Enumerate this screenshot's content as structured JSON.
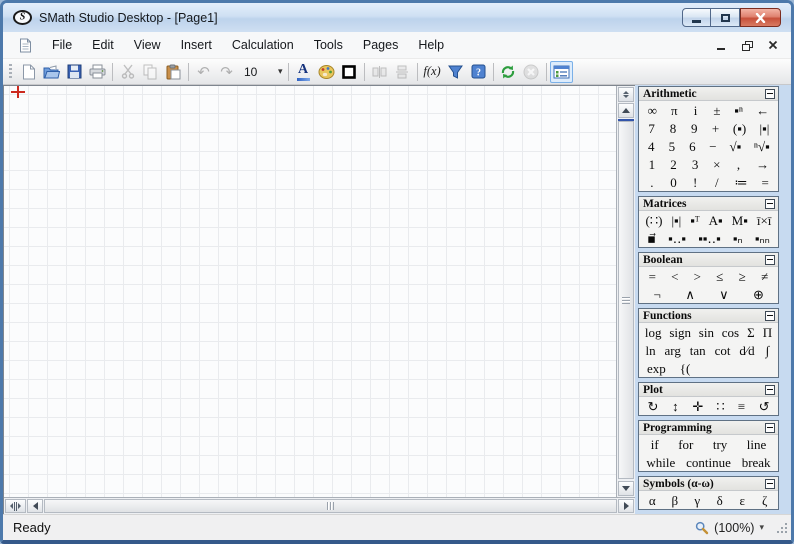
{
  "window": {
    "title": "SMath Studio Desktop - [Page1]",
    "logo_letter": "S"
  },
  "menu": {
    "items": [
      "File",
      "Edit",
      "View",
      "Insert",
      "Calculation",
      "Tools",
      "Pages",
      "Help"
    ]
  },
  "toolbar": {
    "font_size": "10",
    "font_color_label": "A",
    "fx_label": "f(x)",
    "reference_glyph": "?",
    "icons": {
      "undo": "↶",
      "redo": "↷",
      "dropdown_arrow": "▾"
    }
  },
  "palettes": [
    {
      "title": "Arithmetic",
      "rows": [
        [
          "∞",
          "π",
          "i",
          "±",
          "▪ⁿ",
          "←"
        ],
        [
          "7",
          "8",
          "9",
          "+",
          "(▪)",
          "|▪|"
        ],
        [
          "4",
          "5",
          "6",
          "−",
          "√▪",
          "ⁿ√▪"
        ],
        [
          "1",
          "2",
          "3",
          "×",
          ",",
          "→"
        ],
        [
          ".",
          "0",
          "!",
          "/",
          "≔",
          "="
        ]
      ]
    },
    {
      "title": "Matrices",
      "rows": [
        [
          "(∷)",
          "|▪|",
          "▪ᵀ",
          "A▪",
          "M▪",
          "ī×ī"
        ],
        [
          "▪⃗",
          "▪‥▪",
          "▪▪‥▪",
          "▪ₙ",
          "▪ₙₙ"
        ]
      ]
    },
    {
      "title": "Boolean",
      "rows": [
        [
          "=",
          "<",
          ">",
          "≤",
          "≥",
          "≠"
        ],
        [
          "¬",
          "∧",
          "∨",
          "⊕"
        ]
      ]
    },
    {
      "title": "Functions",
      "rows": [
        [
          "log",
          "sign",
          "sin",
          "cos",
          "Σ",
          "Π"
        ],
        [
          "ln",
          "arg",
          "tan",
          "cot",
          "d⁄d",
          "∫"
        ],
        [
          "exp",
          "{("
        ]
      ]
    },
    {
      "title": "Plot",
      "rows": [
        [
          "↻",
          "↕",
          "✛",
          "∷",
          "≡",
          "↺"
        ]
      ]
    },
    {
      "title": "Programming",
      "rows": [
        [
          "if",
          "for",
          "try",
          "line"
        ],
        [
          "while",
          "continue",
          "break"
        ]
      ]
    },
    {
      "title": "Symbols (α-ω)",
      "rows": [
        [
          "α",
          "β",
          "γ",
          "δ",
          "ε",
          "ζ"
        ]
      ]
    }
  ],
  "statusbar": {
    "status": "Ready",
    "zoom_label": "(100%)"
  },
  "colors": {
    "accent_blue": "#3f76c8",
    "active_button_border": "#7ab0e8",
    "grid_line": "#e9ebee",
    "cursor_red": "#cc2a1f"
  }
}
